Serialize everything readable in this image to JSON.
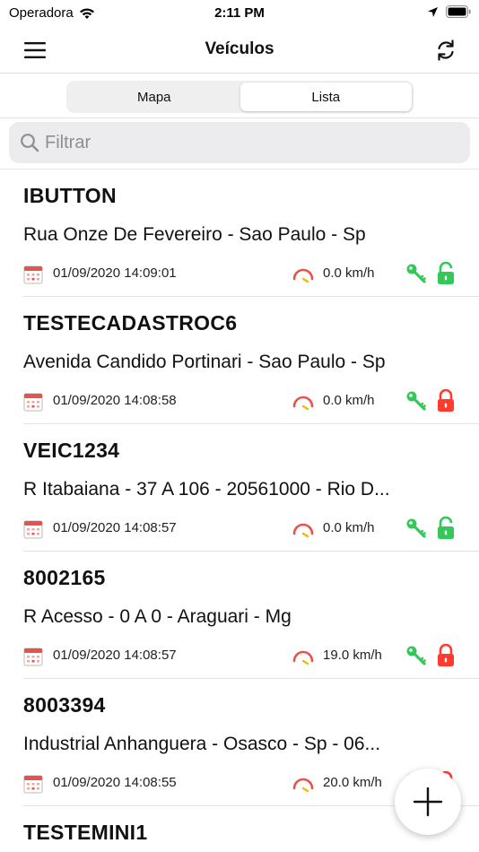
{
  "status_bar": {
    "carrier": "Operadora",
    "time": "2:11 PM"
  },
  "nav": {
    "title": "Veículos"
  },
  "segments": [
    {
      "label": "Mapa",
      "active": false
    },
    {
      "label": "Lista",
      "active": true
    }
  ],
  "search": {
    "placeholder": "Filtrar",
    "value": ""
  },
  "vehicles": [
    {
      "plate": "IBUTTON",
      "address": "Rua Onze De Fevereiro - Sao Paulo - Sp",
      "datetime": "01/09/2020 14:09:01",
      "speed": "0.0 km/h",
      "lock_status": "unlocked"
    },
    {
      "plate": "TESTECADASTROC6",
      "address": "Avenida Candido Portinari - Sao Paulo - Sp",
      "datetime": "01/09/2020 14:08:58",
      "speed": "0.0 km/h",
      "lock_status": "locked"
    },
    {
      "plate": "VEIC1234",
      "address": "R Itabaiana - 37 A 106 - 20561000 - Rio D...",
      "datetime": "01/09/2020 14:08:57",
      "speed": "0.0 km/h",
      "lock_status": "unlocked"
    },
    {
      "plate": "8002165",
      "address": "R Acesso - 0 A 0 - Araguari - Mg",
      "datetime": "01/09/2020 14:08:57",
      "speed": "19.0 km/h",
      "lock_status": "locked"
    },
    {
      "plate": "8003394",
      "address": "Industrial Anhanguera - Osasco - Sp - 06...",
      "datetime": "01/09/2020 14:08:55",
      "speed": "20.0 km/h",
      "lock_status": "locked"
    },
    {
      "plate": "TESTEMINI1"
    }
  ],
  "colors": {
    "key_green": "#34c759",
    "lock_green": "#34c759",
    "lock_red": "#ff3b30",
    "calendar_red": "#e5534b"
  },
  "icons": {
    "menu": "hamburger-menu-icon",
    "refresh": "refresh-icon",
    "search": "search-icon",
    "calendar": "calendar-icon",
    "speedometer": "speedometer-icon",
    "ignition": "key-icon",
    "lock": "lock-icon",
    "add": "plus-icon"
  }
}
